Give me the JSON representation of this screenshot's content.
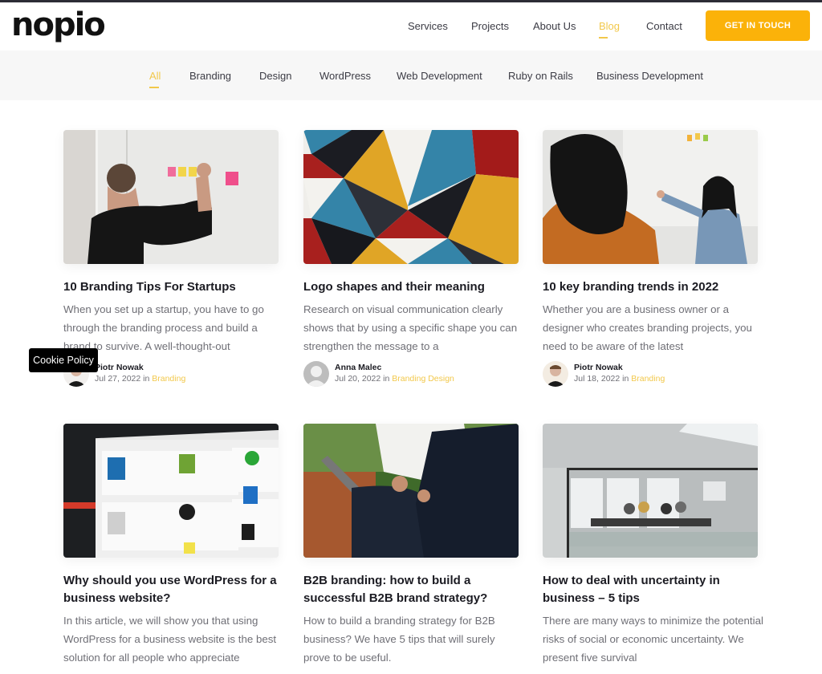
{
  "header": {
    "logo": "nopio",
    "nav": [
      {
        "label": "Services",
        "active": false
      },
      {
        "label": "Projects",
        "active": false
      },
      {
        "label": "About Us",
        "active": false
      },
      {
        "label": "Blog",
        "active": true
      },
      {
        "label": "Contact",
        "active": false
      }
    ],
    "cta_label": "GET IN TOUCH"
  },
  "filters": [
    {
      "label": "All",
      "active": true
    },
    {
      "label": "Branding",
      "active": false
    },
    {
      "label": "Design",
      "active": false
    },
    {
      "label": "WordPress",
      "active": false
    },
    {
      "label": "Web Development",
      "active": false
    },
    {
      "label": "Ruby on Rails",
      "active": false
    },
    {
      "label": "Business Development",
      "active": false
    }
  ],
  "posts": [
    {
      "title": "10 Branding Tips For Startups",
      "excerpt": "When you set up a startup, you have to go through the branding process and build a brand to survive. A well-thought-out",
      "author": "Piotr Nowak",
      "date": "Jul 27, 2022",
      "in": "in",
      "category": "Branding",
      "image": "man-sticky-notes-photo",
      "avatar": "piotr-avatar"
    },
    {
      "title": "Logo shapes and their meaning",
      "excerpt": "Research on visual communication clearly shows that by using a specific shape you can strengthen the message to a",
      "author": "Anna Malec",
      "date": "Jul 20, 2022",
      "in": "in",
      "category": "Branding Design",
      "image": "geometric-triangles-photo",
      "avatar": "default-avatar"
    },
    {
      "title": "10 key branding trends in 2022",
      "excerpt": "Whether you are a business owner or a designer who creates branding projects, you need to be aware of the latest",
      "author": "Piotr Nowak",
      "date": "Jul 18, 2022",
      "in": "in",
      "category": "Branding",
      "image": "whiteboard-women-photo",
      "avatar": "piotr-avatar"
    },
    {
      "title": "Why should you use WordPress for a business website?",
      "excerpt": "In this article, we will show you that using WordPress for a business website is the best solution for all people who appreciate",
      "image": "wordpress-plugins-screen-photo"
    },
    {
      "title": "B2B branding: how to build a successful B2B brand strategy?",
      "excerpt": "How to build a branding strategy for B2B business? We have 5 tips that will surely prove to be useful.",
      "image": "business-tablet-photo"
    },
    {
      "title": "How to deal with uncertainty in business – 5 tips",
      "excerpt": "There are many ways to minimize the potential risks of social or economic uncertainty. We present five survival",
      "image": "office-meeting-room-photo"
    }
  ],
  "cookie_label": "Cookie Policy",
  "colors": {
    "accent": "#f2c84b",
    "cta": "#fbb209",
    "text": "#1b1b22",
    "muted": "#6f6f76",
    "filter_bg": "#f7f7f7"
  }
}
